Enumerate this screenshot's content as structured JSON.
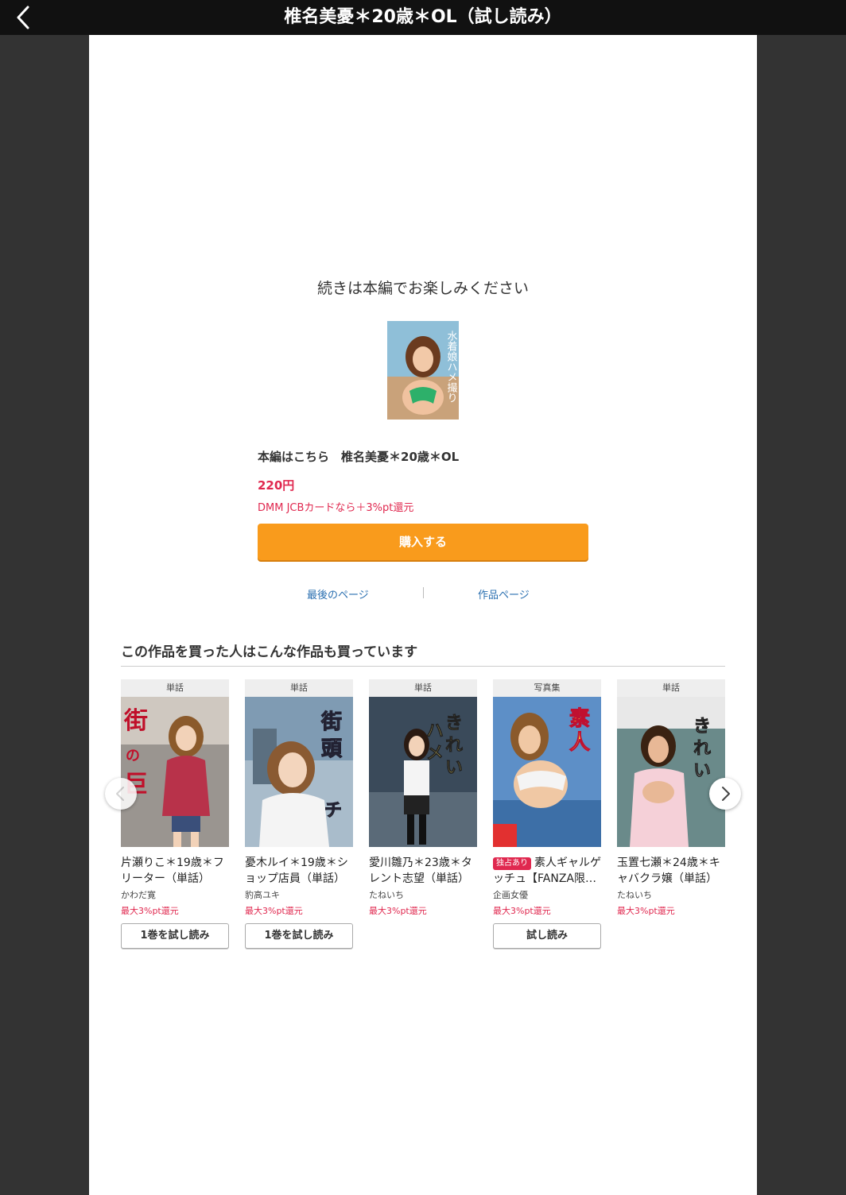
{
  "header": {
    "title": "椎名美憂＊20歳＊OL（試し読み）",
    "back_icon": "chevron-left-icon"
  },
  "end_message": "続きは本編でお楽しみください",
  "product": {
    "cover_text": "水着娘ハメ撮り",
    "label": "本編はこちら　椎名美憂＊20歳＊OL",
    "price": "220円",
    "point_note": "DMM JCBカードなら＋3%pt還元",
    "buy_label": "購入する"
  },
  "links": {
    "last_page": "最後のページ",
    "work_page": "作品ページ"
  },
  "recommend": {
    "title": "この作品を買った人はこんな作品も買っています",
    "cards": [
      {
        "tag": "単話",
        "cover_text": "街の巨乳ガール",
        "title": "片瀬りこ＊19歳＊フリーター（単話）",
        "badge": "",
        "author": "かわだ寛",
        "points": "最大3%pt還元",
        "trial": "1巻を試し読み",
        "cover_color": "#b8324a"
      },
      {
        "tag": "単話",
        "cover_text": "街頭ギャルゲッチュ",
        "title": "憂木ルイ＊19歳＊ショップ店員（単話）",
        "badge": "",
        "author": "豹高ユキ",
        "points": "最大3%pt還元",
        "trial": "1巻を試し読み",
        "cover_color": "#7f9bb3"
      },
      {
        "tag": "単話",
        "cover_text": "きれいなお姉さんをハメ撮りました。",
        "title": "愛川雛乃＊23歳＊タレント志望（単話）",
        "badge": "",
        "author": "たねいち",
        "points": "最大3%pt還元",
        "trial": "",
        "cover_color": "#3a4a5a"
      },
      {
        "tag": "写真集",
        "cover_text": "素人ギャルゲッチュ",
        "title": "素人ギャルゲッチュ【FANZA限…",
        "badge": "独占あり",
        "author": "企画女優",
        "points": "最大3%pt還元",
        "trial": "試し読み",
        "cover_color": "#5d8fc7"
      },
      {
        "tag": "単話",
        "cover_text": "きれいなお姉さんをハメ撮りました。",
        "title": "玉置七瀬＊24歳＊キャバクラ嬢（単話）",
        "badge": "",
        "author": "たねいち",
        "points": "最大3%pt還元",
        "trial": "",
        "cover_color": "#6a8a8a"
      }
    ]
  },
  "colors": {
    "accent": "#f99b1c",
    "price": "#e0284f",
    "link": "#2a6fb0"
  }
}
